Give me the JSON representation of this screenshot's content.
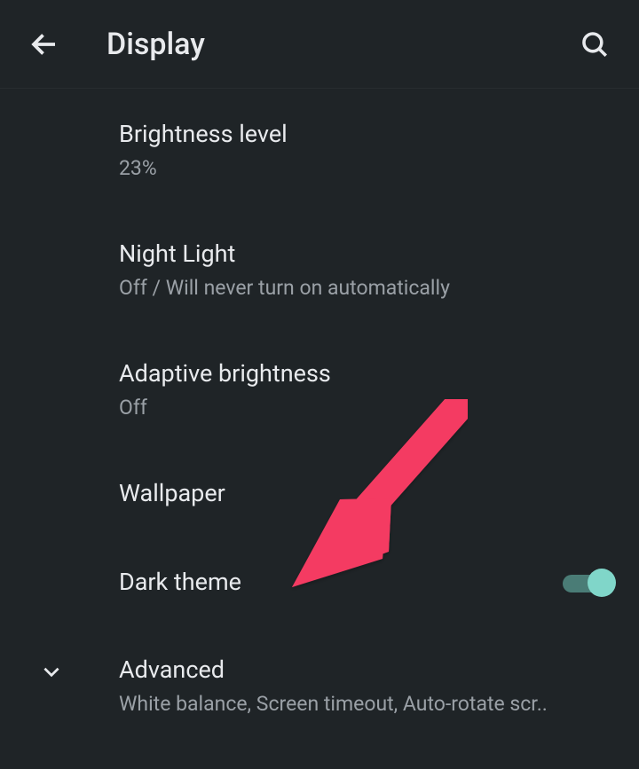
{
  "header": {
    "title": "Display"
  },
  "items": {
    "brightness": {
      "title": "Brightness level",
      "subtitle": "23%"
    },
    "nightlight": {
      "title": "Night Light",
      "subtitle": "Off / Will never turn on automatically"
    },
    "adaptive": {
      "title": "Adaptive brightness",
      "subtitle": "Off"
    },
    "wallpaper": {
      "title": "Wallpaper"
    },
    "darktheme": {
      "title": "Dark theme",
      "enabled": true
    },
    "advanced": {
      "title": "Advanced",
      "subtitle": "White balance, Screen timeout, Auto-rotate scr.."
    }
  },
  "annotation": {
    "color": "#f43b62"
  }
}
